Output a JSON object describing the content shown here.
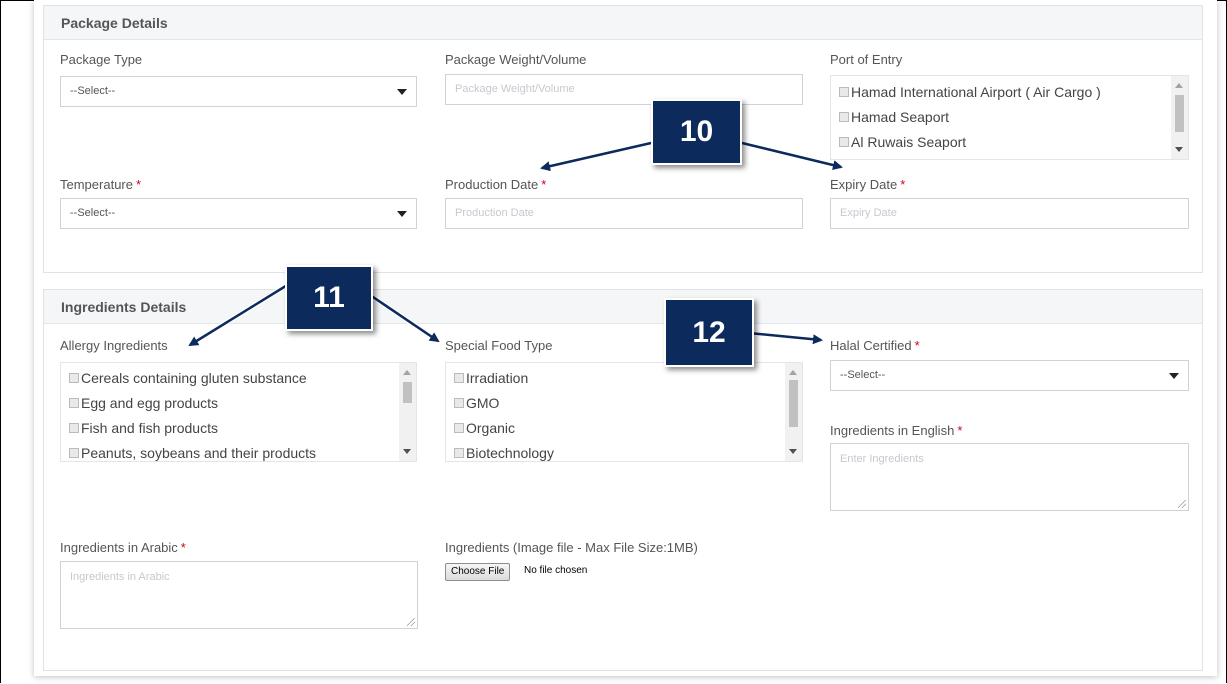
{
  "package_details": {
    "title": "Package Details",
    "package_type": {
      "label": "Package Type",
      "value": "--Select--"
    },
    "package_weight": {
      "label": "Package Weight/Volume",
      "placeholder": "Package Weight/Volume"
    },
    "port_of_entry": {
      "label": "Port of Entry",
      "options": [
        "Hamad International Airport ( Air Cargo )",
        "Hamad Seaport",
        "Al Ruwais Seaport"
      ]
    },
    "temperature": {
      "label": "Temperature",
      "value": "--Select--"
    },
    "production_date": {
      "label": "Production Date",
      "placeholder": "Production Date"
    },
    "expiry_date": {
      "label": "Expiry Date",
      "placeholder": "Expiry Date"
    }
  },
  "ingredients_details": {
    "title": "Ingredients Details",
    "allergy": {
      "label": "Allergy Ingredients",
      "options": [
        "Cereals containing gluten substance",
        "Egg and egg products",
        "Fish and fish products",
        "Peanuts, soybeans and their products"
      ]
    },
    "special_food": {
      "label": "Special Food Type",
      "options": [
        "Irradiation",
        "GMO",
        "Organic",
        "Biotechnology"
      ]
    },
    "halal": {
      "label": "Halal Certified",
      "value": "--Select--"
    },
    "ingredients_english": {
      "label": "Ingredients in English",
      "placeholder": "Enter Ingredients"
    },
    "ingredients_arabic": {
      "label": "Ingredients in Arabic",
      "placeholder": "Ingredients in Arabic"
    },
    "ingredients_image": {
      "label": "Ingredients (Image file - Max File Size:1MB)",
      "button": "Choose File",
      "status": "No file chosen"
    }
  },
  "callouts": [
    "10",
    "11",
    "12"
  ],
  "required_mark": "*",
  "colors": {
    "callout_bg": "#0d2a5c",
    "required": "#d0021b",
    "arrow": "#0d2a5c"
  }
}
